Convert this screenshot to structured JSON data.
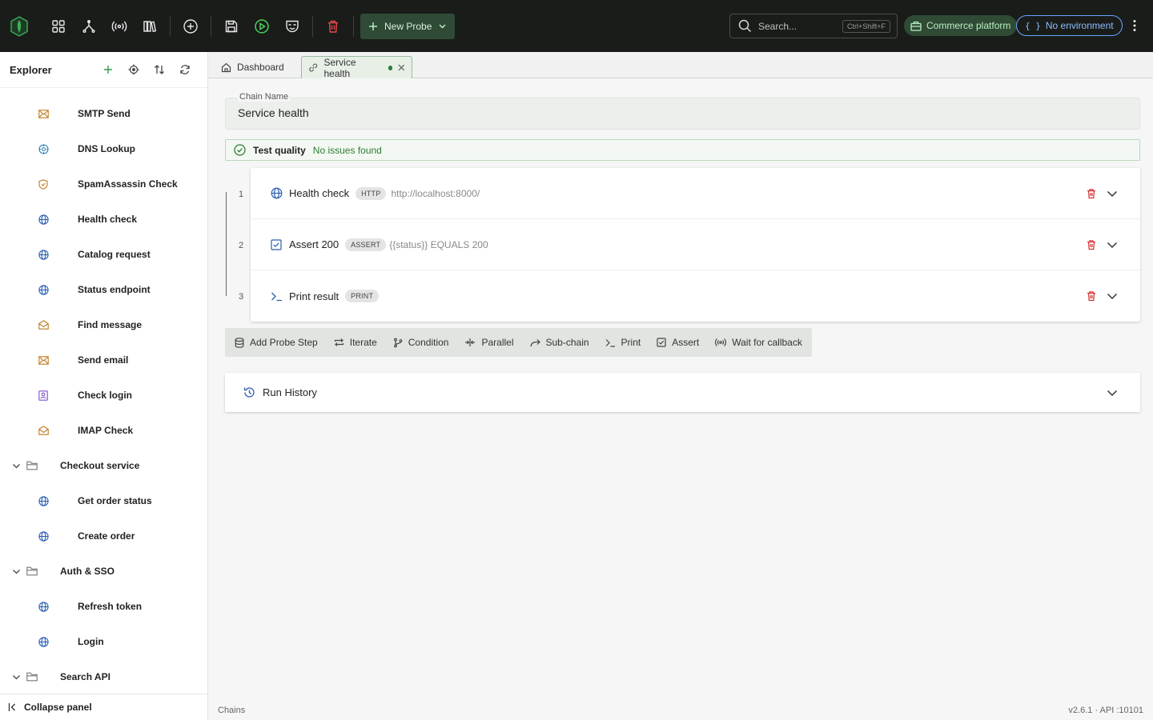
{
  "topbar": {
    "new_probe_label": "New Probe",
    "search_placeholder": "Search...",
    "search_shortcut": "Ctrl+Shift+F",
    "project_label": "Commerce platform",
    "environment_label": "No environment",
    "icons": [
      "app-logo",
      "dashboard-grid-icon",
      "chain-fork-icon",
      "broadcast-icon",
      "library-icon",
      "add-circle-icon",
      "save-icon",
      "run-icon",
      "mask-icon",
      "delete-icon"
    ]
  },
  "sidebar": {
    "title": "Explorer",
    "items": [
      {
        "label": "SMTP Send",
        "type": "probe",
        "icon": "mail-icon"
      },
      {
        "label": "DNS Lookup",
        "type": "probe",
        "icon": "dns-icon"
      },
      {
        "label": "SpamAssassin Check",
        "type": "probe",
        "icon": "shield-icon"
      },
      {
        "label": "Health check",
        "type": "probe",
        "icon": "globe-icon"
      },
      {
        "label": "Catalog request",
        "type": "probe",
        "icon": "globe-icon"
      },
      {
        "label": "Status endpoint",
        "type": "probe",
        "icon": "globe-icon"
      },
      {
        "label": "Find message",
        "type": "probe",
        "icon": "mail-open-icon"
      },
      {
        "label": "Send email",
        "type": "probe",
        "icon": "mail-icon"
      },
      {
        "label": "Check login",
        "type": "probe",
        "icon": "badge-icon"
      },
      {
        "label": "IMAP Check",
        "type": "probe",
        "icon": "mail-open-icon"
      },
      {
        "label": "Checkout service",
        "type": "folder"
      },
      {
        "label": "Get order status",
        "type": "probe",
        "icon": "globe-icon"
      },
      {
        "label": "Create order",
        "type": "probe",
        "icon": "globe-icon"
      },
      {
        "label": "Auth & SSO",
        "type": "folder"
      },
      {
        "label": "Refresh token",
        "type": "probe",
        "icon": "globe-icon"
      },
      {
        "label": "Login",
        "type": "probe",
        "icon": "globe-icon"
      },
      {
        "label": "Search API",
        "type": "folder"
      }
    ],
    "collapse_label": "Collapse panel"
  },
  "tabs": [
    {
      "label": "Dashboard",
      "active": false
    },
    {
      "label": "Service health",
      "active": true,
      "modified": true
    }
  ],
  "chain": {
    "name_label": "Chain Name",
    "name_value": "Service health",
    "quality_title": "Test quality",
    "quality_status": "No issues found"
  },
  "steps": [
    {
      "num": "1",
      "name": "Health check",
      "badge": "HTTP",
      "detail": "http://localhost:8000/",
      "icon": "globe-icon"
    },
    {
      "num": "2",
      "name": "Assert 200",
      "badge": "ASSERT",
      "detail": "{{status}} EQUALS 200",
      "icon": "checkbox-icon"
    },
    {
      "num": "3",
      "name": "Print result",
      "badge": "PRINT",
      "detail": "",
      "icon": "terminal-icon"
    }
  ],
  "toolbar": [
    {
      "label": "Add Probe Step",
      "icon": "database-icon"
    },
    {
      "label": "Iterate",
      "icon": "repeat-icon"
    },
    {
      "label": "Condition",
      "icon": "branch-icon"
    },
    {
      "label": "Parallel",
      "icon": "parallel-icon"
    },
    {
      "label": "Sub-chain",
      "icon": "redo-icon"
    },
    {
      "label": "Print",
      "icon": "terminal-icon"
    },
    {
      "label": "Assert",
      "icon": "checkbox-icon"
    },
    {
      "label": "Wait for callback",
      "icon": "broadcast-icon"
    }
  ],
  "history": {
    "label": "Run History"
  },
  "status": {
    "left": "Chains",
    "right": "v2.6.1 · API :10101"
  },
  "colors": {
    "topbar": "#191c19",
    "accent_green": "#2e7d32",
    "danger": "#d32f2f",
    "env_blue": "#6aa4ff"
  }
}
